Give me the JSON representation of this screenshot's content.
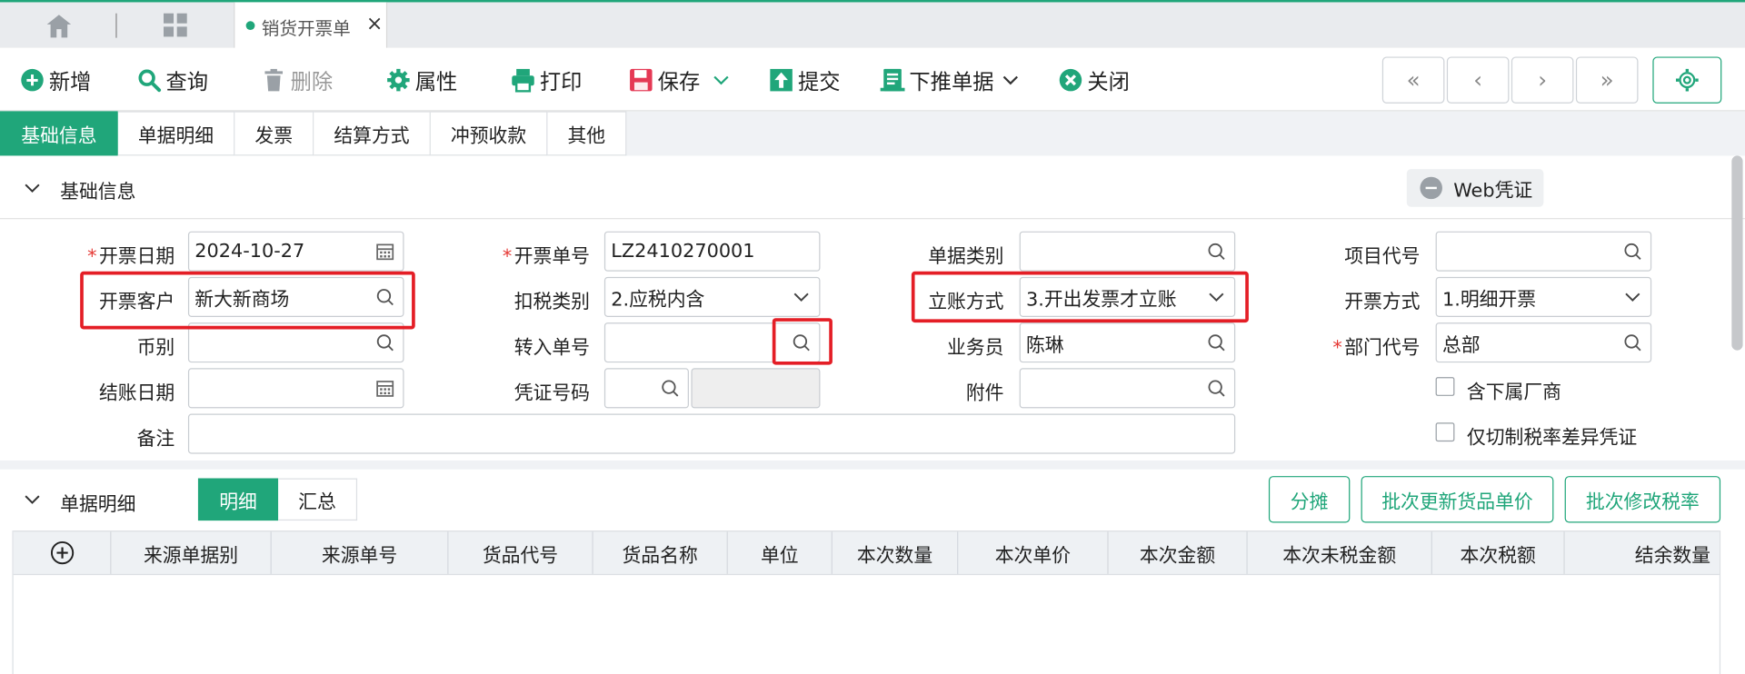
{
  "tabstrip": {
    "doc_tab_label": "销货开票单",
    "close_glyph": "×"
  },
  "toolbar": {
    "add": "新增",
    "query": "查询",
    "delete": "删除",
    "props": "属性",
    "print": "打印",
    "save": "保存",
    "submit": "提交",
    "push_down": "下推单据",
    "close": "关闭"
  },
  "nav": {
    "first": "«",
    "prev": "‹",
    "next": "›",
    "last": "»"
  },
  "section_tabs": [
    "基础信息",
    "单据明细",
    "发票",
    "结算方式",
    "冲预收款",
    "其他"
  ],
  "basic": {
    "title": "基础信息",
    "web_voucher": "Web凭证",
    "labels": {
      "invoice_date": "开票日期",
      "invoice_no": "开票单号",
      "doc_type": "单据类别",
      "project_code": "项目代号",
      "customer": "开票客户",
      "tax_type": "扣税类别",
      "posting_method": "立账方式",
      "invoice_method": "开票方式",
      "currency": "币别",
      "transfer_no": "转入单号",
      "salesperson": "业务员",
      "dept_code": "部门代号",
      "close_date": "结账日期",
      "voucher_no": "凭证号码",
      "attachment": "附件",
      "remark": "备注"
    },
    "values": {
      "invoice_date": "2024-10-27",
      "invoice_no": "LZ2410270001",
      "doc_type": "",
      "project_code": "",
      "customer": "新大新商场",
      "tax_type": "2.应税内含",
      "posting_method": "3.开出发票才立账",
      "invoice_method": "1.明细开票",
      "currency": "",
      "transfer_no": "",
      "salesperson": "陈琳",
      "dept_code": "总部",
      "close_date": "",
      "voucher_no": "",
      "attachment": "",
      "remark": ""
    },
    "checkboxes": {
      "include_sub_vendor": "含下属厂商",
      "only_tax_diff": "仅切制税率差异凭证"
    }
  },
  "details": {
    "title": "单据明细",
    "seg": [
      "明细",
      "汇总"
    ],
    "buttons": {
      "allocate": "分摊",
      "batch_price": "批次更新货品单价",
      "batch_tax": "批次修改税率"
    },
    "columns": [
      "来源单据别",
      "来源单号",
      "货品代号",
      "货品名称",
      "单位",
      "本次数量",
      "本次单价",
      "本次金额",
      "本次未税金额",
      "本次税额",
      "结余数量"
    ]
  },
  "colors": {
    "accent": "#20a67a",
    "highlight": "#e41e26",
    "required": "#e53935"
  }
}
